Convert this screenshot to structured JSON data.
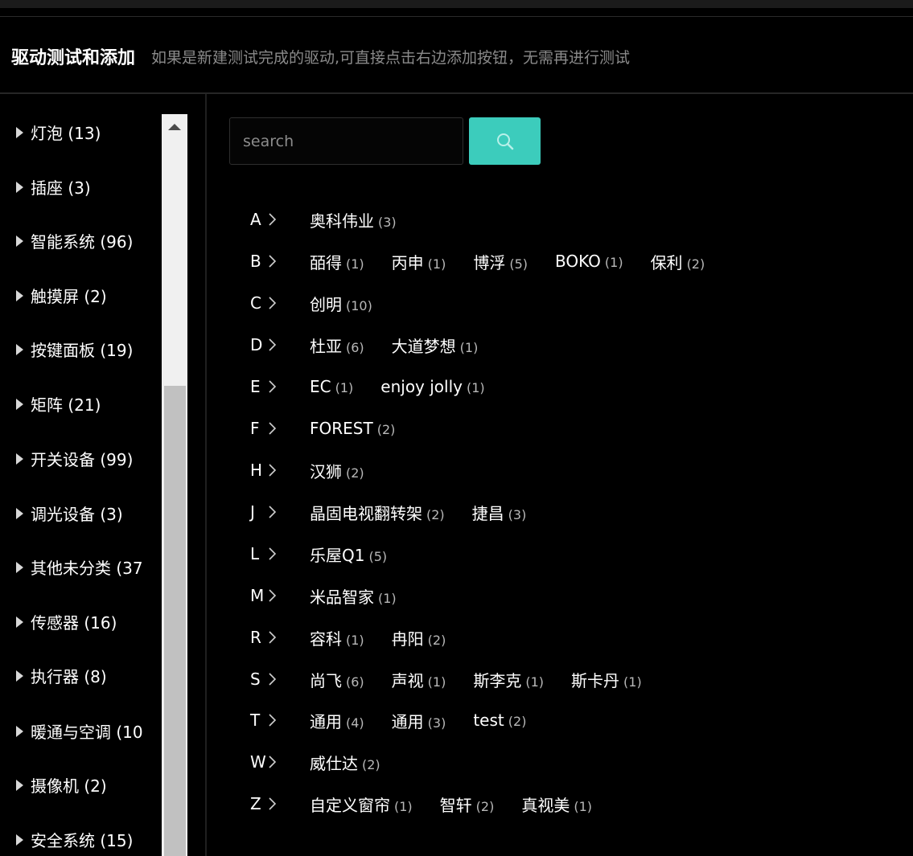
{
  "header": {
    "title": "驱动测试和添加",
    "tip": "如果是新建测试完成的驱动,可直接点击右边添加按钮，无需再进行测试"
  },
  "categories": [
    {
      "label": "灯泡 (13)"
    },
    {
      "label": "插座 (3)"
    },
    {
      "label": "智能系统 (96)"
    },
    {
      "label": "触摸屏 (2)"
    },
    {
      "label": "按键面板 (19)"
    },
    {
      "label": "矩阵 (21)"
    },
    {
      "label": "开关设备 (99)"
    },
    {
      "label": "调光设备 (3)"
    },
    {
      "label": "其他未分类 (37"
    },
    {
      "label": "传感器 (16)"
    },
    {
      "label": "执行器 (8)"
    },
    {
      "label": "暖通与空调 (10"
    },
    {
      "label": "摄像机 (2)"
    },
    {
      "label": "安全系统 (15)"
    }
  ],
  "search": {
    "placeholder": "search",
    "icon": "search-icon"
  },
  "brand_rows": [
    {
      "letter": "A",
      "brands": [
        {
          "name": "奥科伟业",
          "count": "(3)"
        }
      ]
    },
    {
      "letter": "B",
      "brands": [
        {
          "name": "皕得",
          "count": "(1)"
        },
        {
          "name": "丙申",
          "count": "(1)"
        },
        {
          "name": "博浮",
          "count": "(5)"
        },
        {
          "name": "BOKO",
          "count": "(1)"
        },
        {
          "name": "保利",
          "count": "(2)"
        }
      ]
    },
    {
      "letter": "C",
      "brands": [
        {
          "name": "创明",
          "count": "(10)"
        }
      ]
    },
    {
      "letter": "D",
      "brands": [
        {
          "name": "杜亚",
          "count": "(6)"
        },
        {
          "name": "大道梦想",
          "count": "(1)"
        }
      ]
    },
    {
      "letter": "E",
      "brands": [
        {
          "name": "EC",
          "count": "(1)"
        },
        {
          "name": "enjoy jolly",
          "count": "(1)"
        }
      ]
    },
    {
      "letter": "F",
      "brands": [
        {
          "name": "FOREST",
          "count": "(2)"
        }
      ]
    },
    {
      "letter": "H",
      "brands": [
        {
          "name": "汉狮",
          "count": "(2)"
        }
      ]
    },
    {
      "letter": "J",
      "brands": [
        {
          "name": "晶固电视翻转架",
          "count": "(2)"
        },
        {
          "name": "捷昌",
          "count": "(3)"
        }
      ]
    },
    {
      "letter": "L",
      "brands": [
        {
          "name": "乐屋Q1",
          "count": "(5)"
        }
      ]
    },
    {
      "letter": "M",
      "brands": [
        {
          "name": "米品智家",
          "count": "(1)"
        }
      ]
    },
    {
      "letter": "R",
      "brands": [
        {
          "name": "容科",
          "count": "(1)"
        },
        {
          "name": "冉阳",
          "count": "(2)"
        }
      ]
    },
    {
      "letter": "S",
      "brands": [
        {
          "name": "尚飞",
          "count": "(6)"
        },
        {
          "name": "声视",
          "count": "(1)"
        },
        {
          "name": "斯李克",
          "count": "(1)"
        },
        {
          "name": "斯卡丹",
          "count": "(1)"
        }
      ]
    },
    {
      "letter": "T",
      "brands": [
        {
          "name": "通用",
          "count": "(4)"
        },
        {
          "name": "通用",
          "count": "(3)"
        },
        {
          "name": "test",
          "count": "(2)"
        }
      ]
    },
    {
      "letter": "W",
      "brands": [
        {
          "name": "威仕达",
          "count": "(2)"
        }
      ]
    },
    {
      "letter": "Z",
      "brands": [
        {
          "name": "自定义窗帘",
          "count": "(1)"
        },
        {
          "name": "智轩",
          "count": "(2)"
        },
        {
          "name": "真视美",
          "count": "(1)"
        }
      ]
    }
  ],
  "colors": {
    "accent": "#3cccbc",
    "background": "#000000",
    "scrollbar_track": "#f0f0f0",
    "scrollbar_thumb": "#c1c1c1"
  }
}
